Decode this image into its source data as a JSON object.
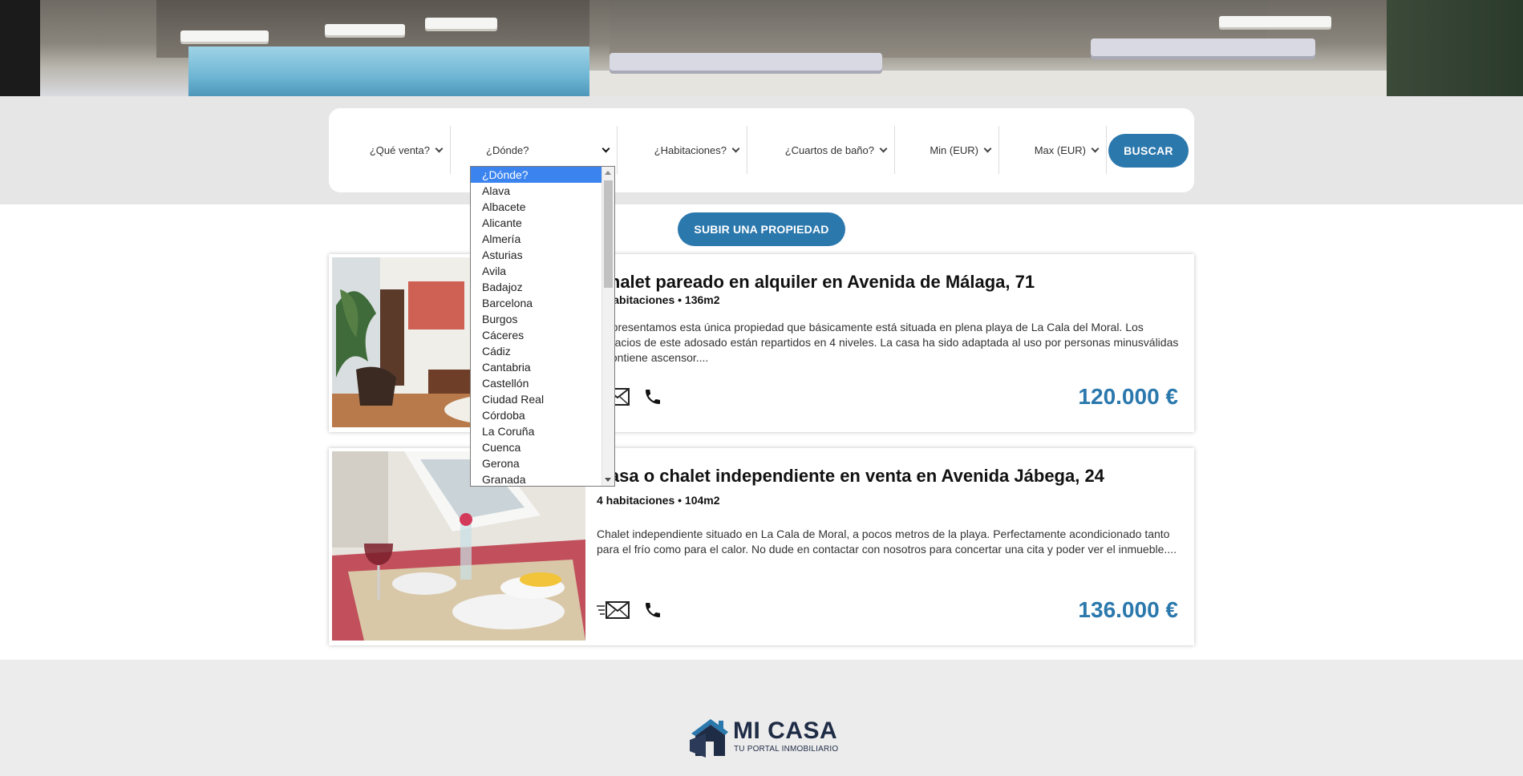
{
  "search": {
    "que_venta": "¿Qué venta?",
    "donde": "¿Dónde?",
    "habitaciones": "¿Habitaciones?",
    "banos": "¿Cuartos de baño?",
    "min": "Min (EUR)",
    "max": "Max (EUR)",
    "buscar_label": "BUSCAR"
  },
  "subir_label": "SUBIR UNA PROPIEDAD",
  "dropdown": {
    "options": [
      "¿Dónde?",
      "Alava",
      "Albacete",
      "Alicante",
      "Almería",
      "Asturias",
      "Avila",
      "Badajoz",
      "Barcelona",
      "Burgos",
      "Cáceres",
      "Cádiz",
      "Cantabria",
      "Castellón",
      "Ciudad Real",
      "Córdoba",
      "La Coruña",
      "Cuenca",
      "Gerona",
      "Granada"
    ],
    "selected_index": 0
  },
  "listings": [
    {
      "title": "Chalet pareado en alquiler en Avenida de Málaga, 71",
      "meta": "4 habitaciones • 136m2",
      "description": "Te presentamos esta única propiedad que básicamente está situada en plena playa de La Cala del Moral. Los espacios de este adosado están repartidos en 4 niveles. La casa ha sido adaptada al uso por personas minusválidas y contiene ascensor....",
      "price": "120.000 €"
    },
    {
      "title": "Casa o chalet independiente en venta en Avenida Jábega, 24",
      "meta": "4 habitaciones • 104m2",
      "description": "Chalet independiente situado en La Cala de Moral, a pocos metros de la playa. Perfectamente acondicionado tanto para el frío como para el calor. No dude en contactar con nosotros para concertar una cita y poder ver el inmueble....",
      "price": "136.000 €"
    }
  ],
  "footer": {
    "brand": "MI CASA",
    "tagline": "TU PORTAL INMOBILIARIO"
  },
  "colors": {
    "accent": "#2b78ad",
    "brand_dark": "#1f2c46",
    "selection": "#3b84f0"
  },
  "icons": [
    "envelope-icon",
    "phone-icon",
    "house-logo-icon",
    "chevron-down-icon"
  ]
}
